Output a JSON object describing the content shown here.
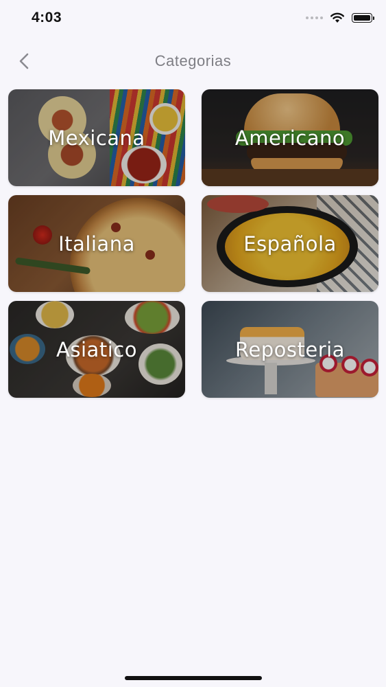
{
  "status_bar": {
    "time": "4:03"
  },
  "nav": {
    "title": "Categorias",
    "back_icon": "chevron-left-icon"
  },
  "categories": [
    {
      "label": "Mexicana"
    },
    {
      "label": "Americano"
    },
    {
      "label": "Italiana"
    },
    {
      "label": "Española"
    },
    {
      "label": "Asiatico"
    },
    {
      "label": "Reposteria"
    }
  ],
  "colors": {
    "background": "#f7f6fb",
    "title": "#7e7e84",
    "card_text": "#ffffff"
  }
}
